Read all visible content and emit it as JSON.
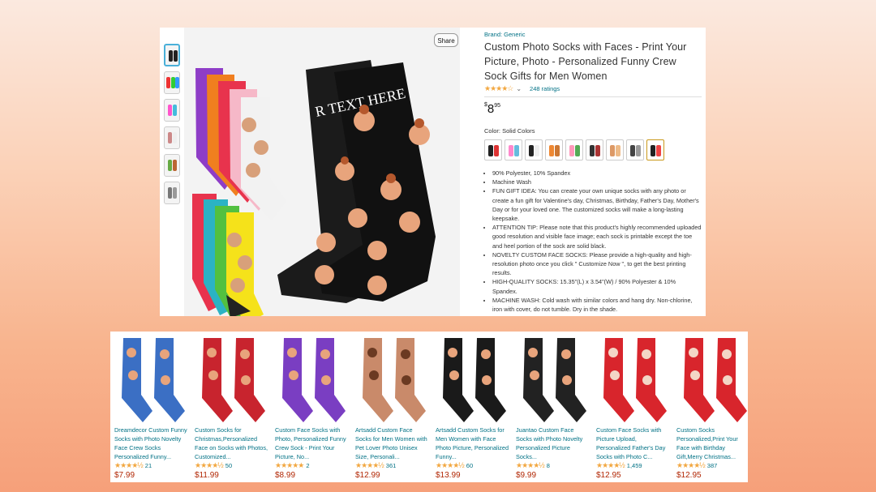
{
  "product": {
    "share_label": "Share",
    "brand": "Brand: Generic",
    "title": "Custom Photo Socks with Faces - Print Your Picture, Photo - Personalized Funny Crew Sock Gifts for Men Women",
    "stars": "★★★★☆",
    "rating_caret": "⌄",
    "ratings_count": "248 ratings",
    "price_symbol": "$",
    "price_whole": "8",
    "price_fraction": "95",
    "color_label": "Color: Solid Colors",
    "sock_text": "R TEXT HERE",
    "rating_color": "#f2a740",
    "link_color": "#007185",
    "price_color": "#b12704",
    "bullets": [
      "90% Polyester, 10% Spandex",
      "Machine Wash",
      "FUN GIFT IDEA: You can create your own unique socks with any photo or create a fun gift for Valentine's day, Christmas, Birthday, Father's Day, Mother's Day or for your loved one. The customized socks will make a long-lasting keepsake.",
      "ATTENTION TIP: Please note that this product's highly recommended uploaded good resolution and visible face image; each sock is printable except the toe and heel portion of the sock are solid black.",
      "NOVELTY CUSTOM FACE SOCKS: Please provide a high-quality and high-resolution photo once you click \" Customize Now \", to get the best printing results.",
      "HIGH-QUALITY SOCKS: 15.35\"(L) x 3.54\"(W) / 90% Polyester & 10% Spandex.",
      "MACHINE WASH: Cold wash with similar colors and hang dry. Non-chlorine, iron with cover, do not tumble. Dry in the shade."
    ]
  },
  "related": [
    {
      "title": "Dreamdecor Custom Funny Socks with Photo Novelty Face Crew Socks Personalized Funny...",
      "stars": "★★★★½",
      "count": "21",
      "price": "$7.99",
      "color": "#3b6fc4"
    },
    {
      "title": "Custom Socks for Christmas,Personalized Face on Socks with Photos, Customized...",
      "stars": "★★★★½",
      "count": "50",
      "price": "$11.99",
      "color": "#c8242e"
    },
    {
      "title": "Custom Face Socks with Photo, Personalized Funny Crew Sock - Print Your Picture, No...",
      "stars": "★★★★★",
      "count": "2",
      "price": "$8.99",
      "color": "#7a3ec2"
    },
    {
      "title": "Artsadd Custom Face Socks for Men Women with Pet Lover Photo Unisex Size, Personali...",
      "stars": "★★★★½",
      "count": "361",
      "price": "$12.99",
      "color": "#c98a6a"
    },
    {
      "title": "Artsadd Custom Socks for Men Women with Face Photo Picture, Personalized Funny...",
      "stars": "★★★★½",
      "count": "60",
      "price": "$13.99",
      "color": "#1a1a1a"
    },
    {
      "title": "Juantao Custom Face Socks with Photo Novelty Personalized Picture Socks...",
      "stars": "★★★★½",
      "count": "8",
      "price": "$9.99",
      "color": "#222222"
    },
    {
      "title": "Custom Face Socks with Picture Upload, Personalized Father's Day Socks with Photo C...",
      "stars": "★★★★½",
      "count": "1,459",
      "price": "$12.95",
      "color": "#d8252c"
    },
    {
      "title": "Custom Socks Personalized,Print Your Face with Birthday Gift,Merry Christmas...",
      "stars": "★★★★½",
      "count": "387",
      "price": "$12.95",
      "color": "#d8252c"
    }
  ]
}
